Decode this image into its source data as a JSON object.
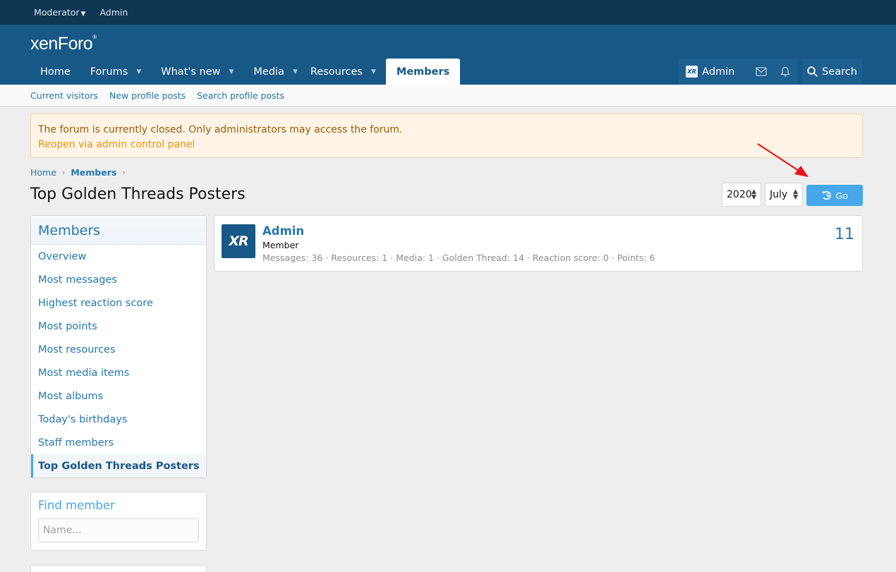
{
  "staffbar": {
    "moderator": "Moderator",
    "admin": "Admin"
  },
  "header": {
    "logo": "xenForo",
    "nav": [
      {
        "label": "Home",
        "dropdown": false
      },
      {
        "label": "Forums",
        "dropdown": true
      },
      {
        "label": "What's new",
        "dropdown": true
      },
      {
        "label": "Media",
        "dropdown": true
      },
      {
        "label": "Resources",
        "dropdown": true
      },
      {
        "label": "Members",
        "dropdown": false,
        "active": true
      }
    ],
    "user": {
      "avatar_text": "XR",
      "name": "Admin"
    },
    "search_label": "Search"
  },
  "subnav": [
    "Current visitors",
    "New profile posts",
    "Search profile posts"
  ],
  "notice": {
    "message": "The forum is currently closed. Only administrators may access the forum.",
    "link": "Reopen via admin control panel"
  },
  "breadcrumb": [
    "Home",
    "Members"
  ],
  "page_title": "Top Golden Threads Posters",
  "filters": {
    "year": "2020",
    "month": "July",
    "go_label": "Go"
  },
  "sidebar": {
    "title": "Members",
    "items": [
      "Overview",
      "Most messages",
      "Highest reaction score",
      "Most points",
      "Most resources",
      "Most media items",
      "Most albums",
      "Today's birthdays",
      "Staff members",
      "Top Golden Threads Posters"
    ],
    "active_index": 9
  },
  "find_member": {
    "title": "Find member",
    "placeholder": "Name..."
  },
  "member": {
    "avatar_text": "XR",
    "name": "Admin",
    "role": "Member",
    "stats": "Messages: 36 · Resources: 1 · Media: 1 · Golden Thread: 14 · Reaction score: 0 · Points: 6",
    "count": "11"
  },
  "colors": {
    "header": "#185886",
    "staffbar": "#0f3652",
    "accent": "#47a7eb",
    "link": "#2577b1",
    "annotation_arrow": "#e8141c"
  }
}
